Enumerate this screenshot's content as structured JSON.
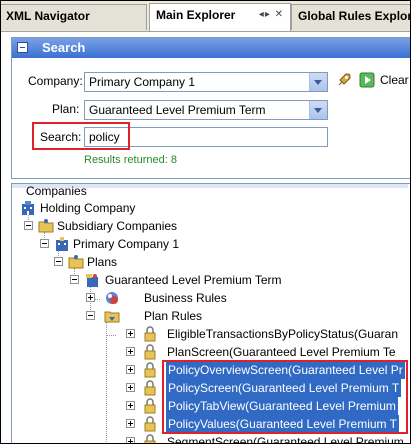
{
  "tabs": [
    {
      "label": "XML Navigator",
      "active": false
    },
    {
      "label": "Main Explorer",
      "active": true,
      "controls": "◂▸ ✕"
    },
    {
      "label": "Global Rules Explorer",
      "active": false
    }
  ],
  "search_panel": {
    "title": "Search",
    "company_label": "Company:",
    "company_value": "Primary Company 1",
    "plan_label": "Plan:",
    "plan_value": "Guaranteed Level Premium Term",
    "search_label": "Search:",
    "search_value": "policy",
    "clear_label": "Clear",
    "results_text": "Results returned: 8"
  },
  "tree": {
    "root": "Companies",
    "nodes": [
      {
        "label": "Holding Company",
        "icon": "building-icon"
      },
      {
        "label": "Subsidiary Companies",
        "icon": "folder-icon"
      },
      {
        "label": "Primary Company 1",
        "icon": "company-icon"
      },
      {
        "label": "Plans",
        "icon": "folder-icon"
      },
      {
        "label": "Guaranteed Level Premium Term",
        "icon": "plan-icon"
      },
      {
        "label": "Business Rules",
        "icon": "rules-icon"
      },
      {
        "label": "Plan Rules",
        "icon": "folder-icon"
      },
      {
        "label": "EligibleTransactionsByPolicyStatus(Guaran",
        "icon": "lock-rule-icon"
      },
      {
        "label": "PlanScreen(Guaranteed Level Premium Te",
        "icon": "lock-rule-icon"
      },
      {
        "label": "PolicyOverviewScreen(Guaranteed Level Pr",
        "icon": "lock-rule-icon"
      },
      {
        "label": "PolicyScreen(Guaranteed Level Premium T",
        "icon": "lock-rule-icon"
      },
      {
        "label": "PolicyTabView(Guaranteed Level Premium",
        "icon": "lock-rule-icon"
      },
      {
        "label": "PolicyValues(Guaranteed Level Premium T",
        "icon": "lock-rule-icon"
      },
      {
        "label": "SegmentScreen(Guaranteed Level Premium",
        "icon": "lock-rule-icon"
      }
    ]
  },
  "colors": {
    "selection": "#316ac5",
    "highlight_box": "#e0202a",
    "results_text": "#2a8a2a",
    "panel_header": "#3b6fd1"
  }
}
